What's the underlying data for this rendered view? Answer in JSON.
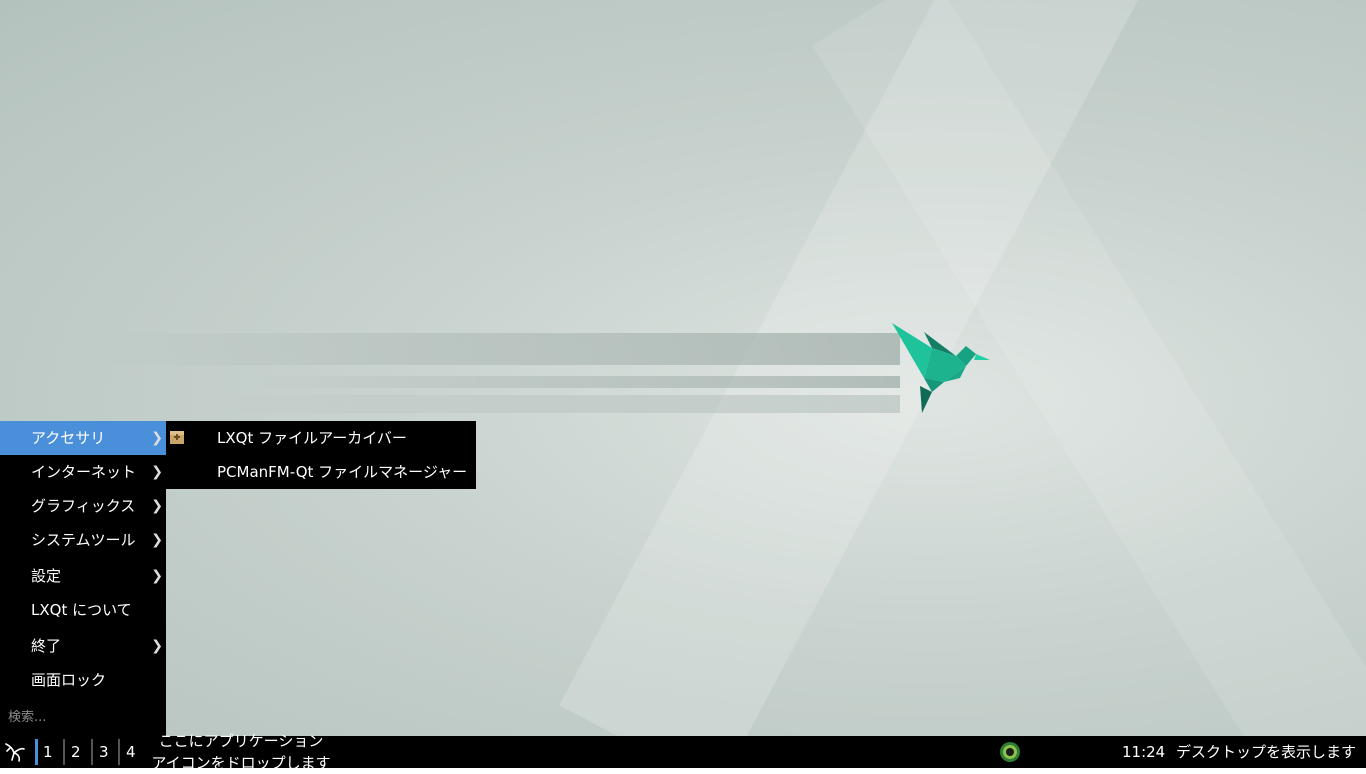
{
  "main_menu": {
    "items": [
      {
        "label": "アクセサリ",
        "has_submenu": true,
        "active": true
      },
      {
        "label": "インターネット",
        "has_submenu": true
      },
      {
        "label": "グラフィックス",
        "has_submenu": true
      },
      {
        "label": "システムツール",
        "has_submenu": true
      },
      {
        "label": "設定",
        "has_submenu": true
      },
      {
        "label": "LXQt について",
        "has_submenu": false
      },
      {
        "label": "終了",
        "has_submenu": true
      },
      {
        "label": "画面ロック",
        "has_submenu": false
      }
    ],
    "search_placeholder": "検索..."
  },
  "submenu": {
    "items": [
      {
        "label": "LXQt ファイルアーカイバー",
        "icon": "archive-icon"
      },
      {
        "label": "PCManFM-Qt ファイルマネージャー",
        "icon": ""
      }
    ]
  },
  "taskbar": {
    "desktops": [
      "1",
      "2",
      "3",
      "4"
    ],
    "active_desktop": "1",
    "quicklaunch_hint_line1": "ここにアプリケーション",
    "quicklaunch_hint_line2": "アイコンをドロップします",
    "clock": "11:24",
    "show_desktop": "デスクトップを表示します"
  },
  "colors": {
    "accent": "#4a8fd9",
    "menu_bg": "#000000",
    "bird": "#1db38f"
  }
}
